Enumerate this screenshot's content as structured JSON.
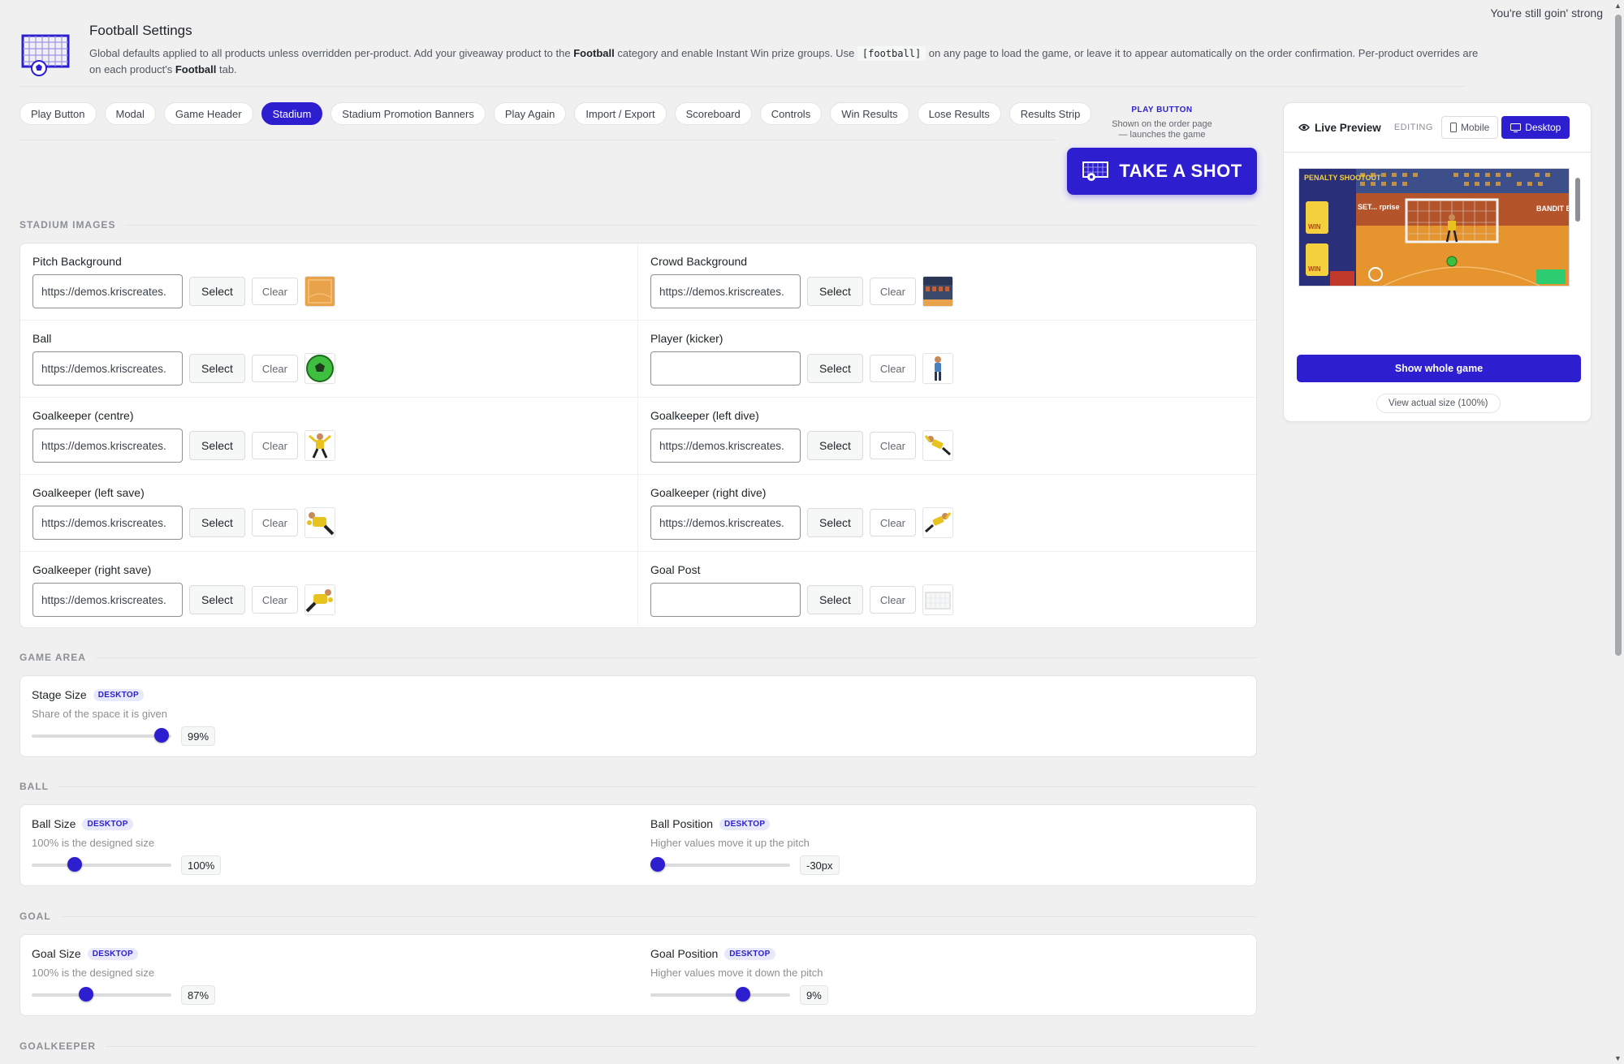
{
  "top_note": "You're still goin' strong",
  "header": {
    "title": "Football Settings",
    "desc_1": "Global defaults applied to all products unless overridden per-product. Add your giveaway product to the ",
    "desc_bold_1": "Football",
    "desc_2": " category and enable Instant Win prize groups. Use ",
    "desc_code": "[football]",
    "desc_3": " on any page to load the game, or leave it to appear automatically on the order confirmation. Per-product overrides are on each product's ",
    "desc_bold_2": "Football",
    "desc_4": " tab."
  },
  "tabs": [
    {
      "label": "Play Button"
    },
    {
      "label": "Modal"
    },
    {
      "label": "Game Header"
    },
    {
      "label": "Stadium",
      "active": true
    },
    {
      "label": "Stadium Promotion Banners"
    },
    {
      "label": "Play Again"
    },
    {
      "label": "Import / Export"
    },
    {
      "label": "Scoreboard"
    },
    {
      "label": "Controls"
    },
    {
      "label": "Win Results"
    },
    {
      "label": "Lose Results"
    },
    {
      "label": "Results Strip"
    }
  ],
  "play_button_preview": {
    "label": "PLAY BUTTON",
    "sub_1": "Shown on the order page",
    "sub_2": "— launches the game",
    "button_text": "TAKE A SHOT",
    "button_color": "#2d1fd0"
  },
  "sections": {
    "stadium_images": "STADIUM IMAGES",
    "game_area": "GAME AREA",
    "ball": "BALL",
    "goal": "GOAL",
    "goalkeeper": "GOALKEEPER"
  },
  "buttons": {
    "select": "Select",
    "clear": "Clear"
  },
  "images": [
    {
      "name": "Pitch Background",
      "value": "https://demos.kriscreates.",
      "thumb": "pitch-thumb"
    },
    {
      "name": "Crowd Background",
      "value": "https://demos.kriscreates.",
      "thumb": "crowd-thumb"
    },
    {
      "name": "Ball",
      "value": "https://demos.kriscreates.",
      "thumb": "ball-thumb"
    },
    {
      "name": "Player (kicker)",
      "value": "",
      "thumb": "kicker-thumb"
    },
    {
      "name": "Goalkeeper (centre)",
      "value": "https://demos.kriscreates.",
      "thumb": "keeper-centre-thumb"
    },
    {
      "name": "Goalkeeper (left dive)",
      "value": "https://demos.kriscreates.",
      "thumb": "keeper-left-dive-thumb"
    },
    {
      "name": "Goalkeeper (left save)",
      "value": "https://demos.kriscreates.",
      "thumb": "keeper-left-save-thumb"
    },
    {
      "name": "Goalkeeper (right dive)",
      "value": "https://demos.kriscreates.",
      "thumb": "keeper-right-dive-thumb"
    },
    {
      "name": "Goalkeeper (right save)",
      "value": "https://demos.kriscreates.",
      "thumb": "keeper-right-save-thumb"
    },
    {
      "name": "Goal Post",
      "value": "",
      "thumb": "goal-post-thumb"
    }
  ],
  "sliders": {
    "stage_size": {
      "title": "Stage Size",
      "badge": "DESKTOP",
      "desc": "Share of the space it is given",
      "value_text": "99%",
      "fraction": 0.93
    },
    "ball_size": {
      "title": "Ball Size",
      "badge": "DESKTOP",
      "desc": "100% is the designed size",
      "value_text": "100%",
      "fraction": 0.31
    },
    "ball_position": {
      "title": "Ball Position",
      "badge": "DESKTOP",
      "desc": "Higher values move it up the pitch",
      "value_text": "-30px",
      "fraction": 0.05
    },
    "goal_size": {
      "title": "Goal Size",
      "badge": "DESKTOP",
      "desc": "100% is the designed size",
      "value_text": "87%",
      "fraction": 0.39
    },
    "goal_position": {
      "title": "Goal Position",
      "badge": "DESKTOP",
      "desc": "Higher values move it down the pitch",
      "value_text": "9%",
      "fraction": 0.66
    }
  },
  "preview": {
    "title": "Live Preview",
    "editing": "EDITING",
    "mobile": "Mobile",
    "desktop": "Desktop",
    "show_whole": "Show whole game",
    "view_actual": "View actual size (100%)",
    "img_text_left": "PENALTY SHOOTOUT",
    "img_text_mid": "SET... rprise",
    "img_text_right": "BANDIT BOUT",
    "img_win": "WIN"
  }
}
